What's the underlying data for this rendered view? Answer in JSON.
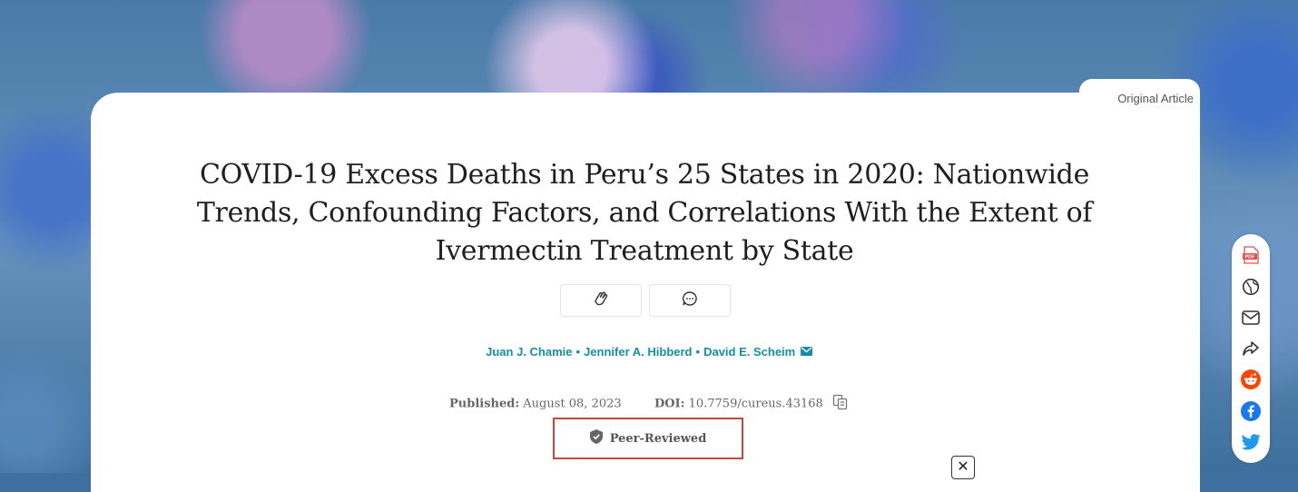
{
  "article": {
    "type_badge": "Original Article",
    "title": "COVID-19 Excess Deaths in Peru’s 25 States in 2020: Nationwide Trends, Confounding Factors, and Correlations With the Extent of Ivermectin Treatment by State",
    "authors": [
      "Juan J. Chamie",
      "Jennifer A. Hibberd",
      "David E. Scheim"
    ],
    "published_label": "Published:",
    "published_date": "August 08, 2023",
    "doi_label": "DOI:",
    "doi_value": "10.7759/cureus.43168",
    "peer_reviewed": "Peer-Reviewed"
  },
  "sidebar": {
    "icons": [
      "pdf-icon",
      "globe-icon",
      "email-icon",
      "share-icon",
      "reddit-icon",
      "facebook-icon",
      "twitter-icon"
    ]
  },
  "close_label": "✕",
  "colors": {
    "author_link": "#158fa4",
    "highlight_border": "#c8473a",
    "reddit": "#ff4500",
    "facebook": "#1877f2",
    "twitter": "#1d9bf0"
  }
}
